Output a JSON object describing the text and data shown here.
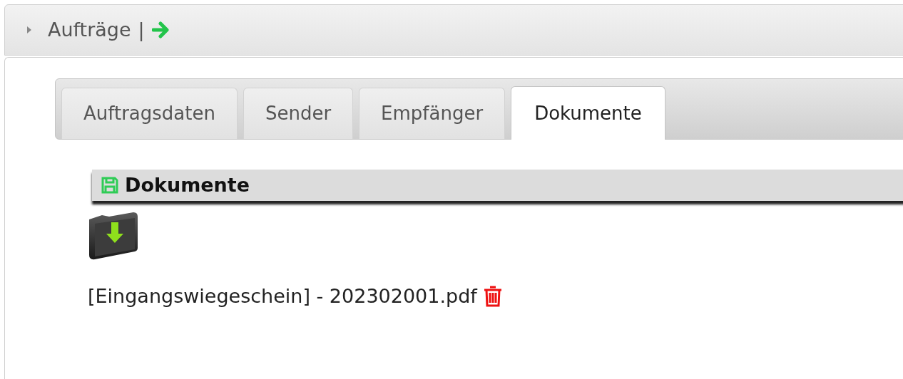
{
  "header": {
    "title": "Aufträge",
    "separator": "|",
    "expanded": false
  },
  "tabs": [
    {
      "label": "Auftragsdaten",
      "selected": false
    },
    {
      "label": "Sender",
      "selected": false
    },
    {
      "label": "Empfänger",
      "selected": false
    },
    {
      "label": "Dokumente",
      "selected": true
    }
  ],
  "section": {
    "title": "Dokumente"
  },
  "files": [
    {
      "label": "[Eingangswiegeschein] - 202302001.pdf"
    }
  ]
}
